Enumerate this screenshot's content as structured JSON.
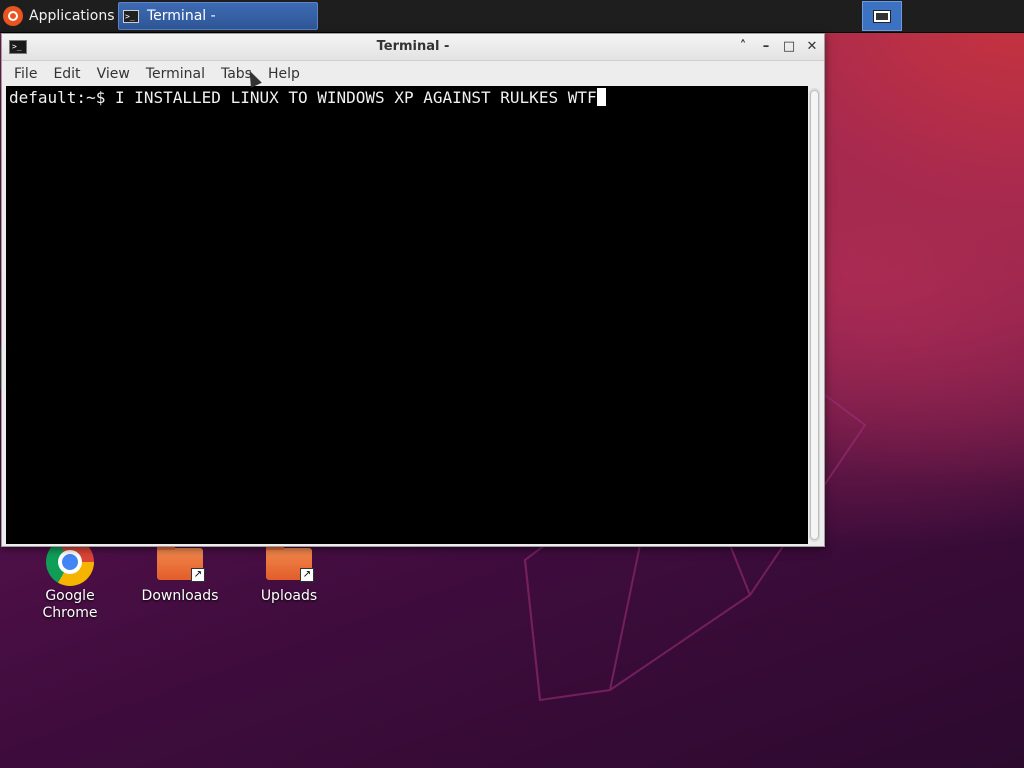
{
  "panel": {
    "applications_label": "Applications",
    "applications_separator": "≡",
    "task_label": "Terminal -",
    "icons": {
      "menu": "ubuntu-logo-icon",
      "task": "terminal-icon",
      "workspace": "workspace-icon"
    }
  },
  "window": {
    "title": "Terminal -",
    "icon": "terminal-icon",
    "controls": {
      "up": "˄",
      "minimize": "–",
      "maximize": "□",
      "close": "✕"
    },
    "menu": [
      "File",
      "Edit",
      "View",
      "Terminal",
      "Tabs",
      "Help"
    ],
    "terminal": {
      "prompt": "default:~$",
      "command": "I INSTALLED LINUX TO WINDOWS XP AGAINST RULKES WTF"
    }
  },
  "desktop": {
    "icons": [
      {
        "label": "Google Chrome",
        "icon": "chrome-icon"
      },
      {
        "label": "Downloads",
        "icon": "folder-link-icon"
      },
      {
        "label": "Uploads",
        "icon": "folder-link-icon"
      }
    ]
  },
  "colors": {
    "panel": "#1e1e1e",
    "task_active": "#3d6ab3",
    "ubuntu_orange": "#e95420",
    "terminal_bg": "#000000",
    "desktop_purple": "#5a1250"
  }
}
